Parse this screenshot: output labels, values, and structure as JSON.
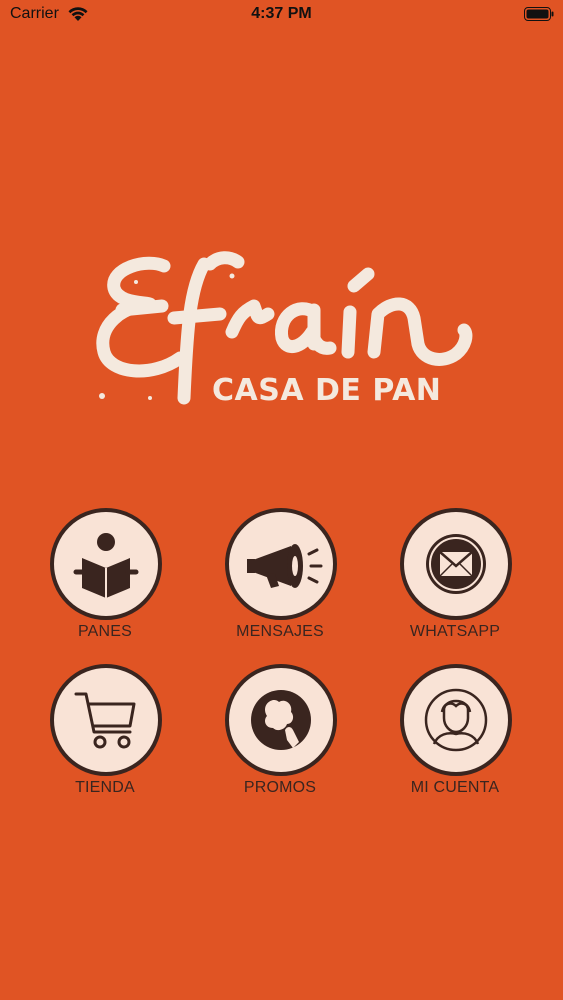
{
  "status_bar": {
    "carrier": "Carrier",
    "time": "4:37 PM"
  },
  "logo": {
    "script": "Efrain",
    "subtitle": "CASA DE PAN"
  },
  "menu": [
    {
      "label": "PANES",
      "icon": "reading-book-icon"
    },
    {
      "label": "MENSAJES",
      "icon": "megaphone-icon"
    },
    {
      "label": "WHATSAPP",
      "icon": "envelope-icon"
    },
    {
      "label": "TIENDA",
      "icon": "shopping-cart-icon"
    },
    {
      "label": "PROMOS",
      "icon": "hand-pointing-icon"
    },
    {
      "label": "MI CUENTA",
      "icon": "user-avatar-icon"
    }
  ],
  "colors": {
    "background": "#E05424",
    "circle_fill": "#F9E3D6",
    "dark_brown": "#3A251F",
    "logo_cream": "#F4E9DE"
  }
}
